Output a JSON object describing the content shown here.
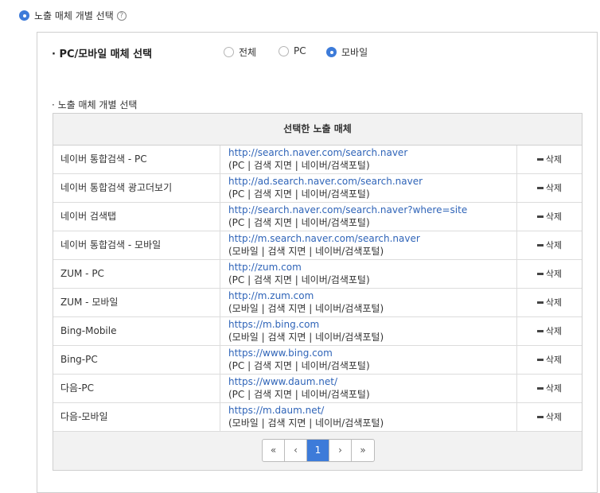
{
  "header": {
    "label": "노출 매체 개별 선택",
    "help_icon": "?"
  },
  "media_select": {
    "title": "· PC/모바일 매체 선택",
    "options": [
      {
        "label": "전체",
        "checked": false
      },
      {
        "label": "PC",
        "checked": false
      },
      {
        "label": "모바일",
        "checked": true
      }
    ]
  },
  "individual": {
    "title": "· 노출 매체 개별 선택"
  },
  "table": {
    "header": "선택한 노출 매체",
    "delete_label": "삭제",
    "rows": [
      {
        "name": "네이버 통합검색 - PC",
        "url": "http://search.naver.com/search.naver",
        "desc": "(PC | 검색 지면 | 네이버/검색포털)"
      },
      {
        "name": "네이버 통합검색 광고더보기",
        "url": "http://ad.search.naver.com/search.naver",
        "desc": "(PC | 검색 지면 | 네이버/검색포털)"
      },
      {
        "name": "네이버 검색탭",
        "url": "http://search.naver.com/search.naver?where=site",
        "desc": "(PC | 검색 지면 | 네이버/검색포털)"
      },
      {
        "name": "네이버 통합검색 - 모바일",
        "url": "http://m.search.naver.com/search.naver",
        "desc": "(모바일 | 검색 지면 | 네이버/검색포털)"
      },
      {
        "name": "ZUM - PC",
        "url": "http://zum.com",
        "desc": "(PC | 검색 지면 | 네이버/검색포털)"
      },
      {
        "name": "ZUM - 모바일",
        "url": "http://m.zum.com",
        "desc": "(모바일 | 검색 지면 | 네이버/검색포털)"
      },
      {
        "name": "Bing-Mobile",
        "url": "https://m.bing.com",
        "desc": "(모바일 | 검색 지면 | 네이버/검색포털)"
      },
      {
        "name": "Bing-PC",
        "url": "https://www.bing.com",
        "desc": "(PC | 검색 지면 | 네이버/검색포털)"
      },
      {
        "name": "다음-PC",
        "url": "https://www.daum.net/",
        "desc": "(PC | 검색 지면 | 네이버/검색포털)"
      },
      {
        "name": "다음-모바일",
        "url": "https://m.daum.net/",
        "desc": "(모바일 | 검색 지면 | 네이버/검색포털)"
      }
    ]
  },
  "pagination": {
    "first": "«",
    "prev": "‹",
    "current": "1",
    "next": "›",
    "last": "»"
  }
}
